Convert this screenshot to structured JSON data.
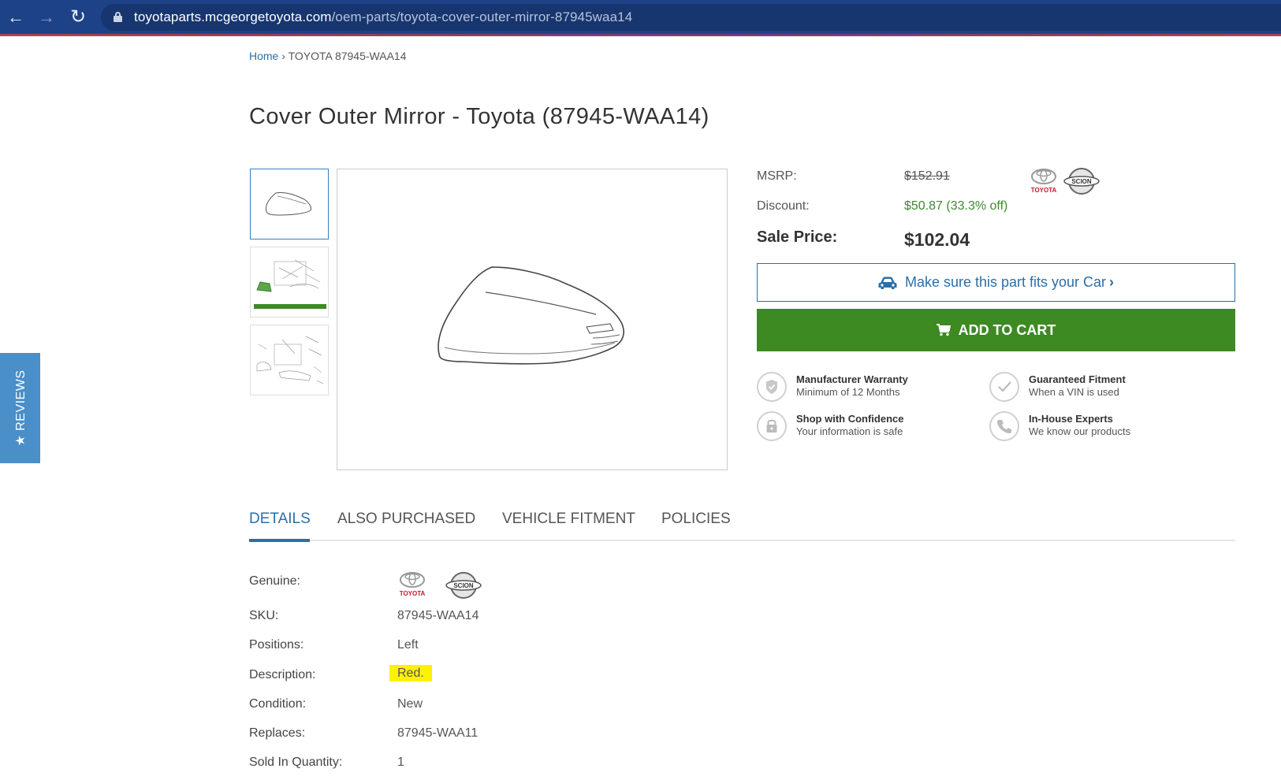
{
  "browser": {
    "back_icon": "arrow-left-icon",
    "forward_icon": "arrow-right-icon",
    "reload_icon": "reload-icon",
    "url_domain": "toyotaparts.mcgeorgetoyota.com",
    "url_path": "/oem-parts/toyota-cover-outer-mirror-87945waa14"
  },
  "breadcrumb": {
    "home": "Home",
    "separator": "›",
    "current": "TOYOTA 87945-WAA14"
  },
  "title": "Cover Outer Mirror - Toyota (87945-WAA14)",
  "pricing": {
    "msrp_label": "MSRP:",
    "msrp_value": "$152.91",
    "discount_label": "Discount:",
    "discount_value": "$50.87 (33.3% off)",
    "sale_label": "Sale Price:",
    "sale_value": "$102.04"
  },
  "brands": {
    "toyota_text": "TOYOTA",
    "scion_text": "SCION"
  },
  "actions": {
    "fit_label": "Make sure this part fits your Car",
    "fit_chevron": "›",
    "cart_label": "ADD TO CART"
  },
  "features": [
    {
      "title": "Manufacturer Warranty",
      "subtitle": "Minimum of 12 Months",
      "icon": "shield-check-icon"
    },
    {
      "title": "Guaranteed Fitment",
      "subtitle": "When a VIN is used",
      "icon": "checkmark-icon"
    },
    {
      "title": "Shop with Confidence",
      "subtitle": "Your information is safe",
      "icon": "lock-icon"
    },
    {
      "title": "In-House Experts",
      "subtitle": "We know our products",
      "icon": "phone-icon"
    }
  ],
  "reviews_tab": "★ REVIEWS",
  "tabs": [
    {
      "label": "DETAILS",
      "active": true
    },
    {
      "label": "ALSO PURCHASED",
      "active": false
    },
    {
      "label": "VEHICLE FITMENT",
      "active": false
    },
    {
      "label": "POLICIES",
      "active": false
    }
  ],
  "details": [
    {
      "label": "Genuine:",
      "value": ""
    },
    {
      "label": "SKU:",
      "value": "87945-WAA14"
    },
    {
      "label": "Positions:",
      "value": "Left"
    },
    {
      "label": "Description:",
      "value": "Red."
    },
    {
      "label": "Condition:",
      "value": "New"
    },
    {
      "label": "Replaces:",
      "value": "87945-WAA11"
    },
    {
      "label": "Sold In Quantity:",
      "value": "1"
    }
  ],
  "colors": {
    "browser_bar": "#1e4287",
    "link_blue": "#2a6fa8",
    "cart_green": "#3d8a23",
    "discount_green": "#3d8a2f",
    "reviews_blue": "#4a8fc7",
    "highlight_yellow": "#fff200",
    "toyota_red": "#d0142c"
  }
}
